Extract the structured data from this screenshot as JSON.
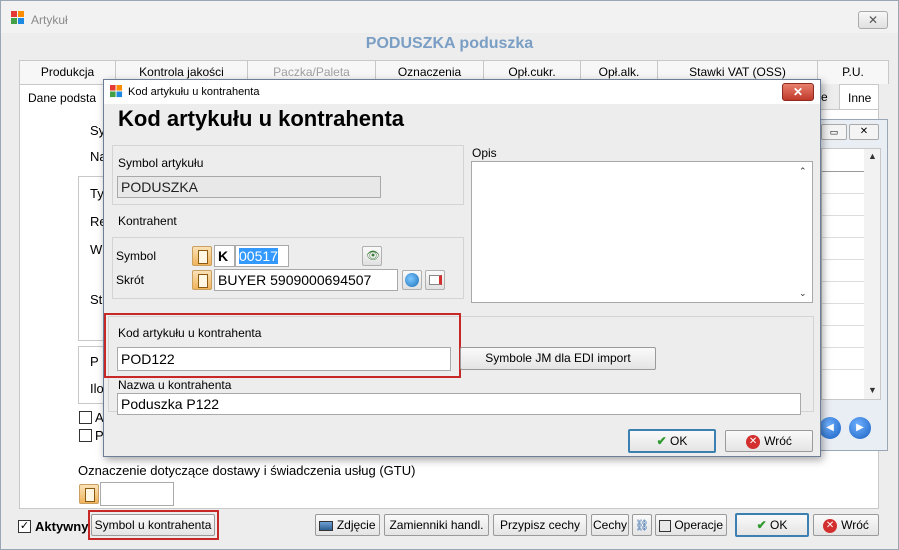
{
  "window": {
    "title": "Artykuł",
    "item_title": "PODUSZKA  poduszka"
  },
  "tabs_row1": [
    {
      "label": "Produkcja",
      "disabled": false
    },
    {
      "label": "Kontrola jakości",
      "disabled": false
    },
    {
      "label": "Paczka/Paleta",
      "disabled": true
    },
    {
      "label": "Oznaczenia",
      "disabled": false
    },
    {
      "label": "Opł.cukr.",
      "disabled": false
    },
    {
      "label": "Opł.alk.",
      "disabled": false
    },
    {
      "label": "Stawki VAT (OSS)",
      "disabled": false
    },
    {
      "label": "P.U.",
      "disabled": false
    }
  ],
  "tabs_row2": {
    "first": "Dane podsta",
    "e": "e",
    "inne": "Inne"
  },
  "background_labels": {
    "sy": "Sy",
    "na": "Na",
    "ty": "Ty",
    "re": "Re",
    "w": "W",
    "st": "St",
    "p": "P",
    "ilo": "Ilo",
    "a": "A",
    "p2": "P"
  },
  "gtu": {
    "label": "Oznaczenie dotyczące dostawy i świadczenia usług (GTU)",
    "value": ""
  },
  "footer": {
    "active_label": "Aktywny",
    "active_checked": true,
    "symbol_button": "Symbol u kontrahenta",
    "photo_button": "Zdjęcie",
    "substitutes_button": "Zamienniki handl.",
    "assign_features_button": "Przypisz cechy",
    "features_button": "Cechy",
    "operations_button": "Operacje",
    "ok_button": "OK",
    "back_button": "Wróć"
  },
  "dialog": {
    "title": "Kod artykułu u kontrahenta",
    "heading": "Kod artykułu u kontrahenta",
    "symbol_label": "Symbol artykułu",
    "symbol_value": "PODUSZKA",
    "contractor_label": "Kontrahent",
    "contractor_symbol_label": "Symbol",
    "contractor_type": "K",
    "contractor_symbol_value": "00517",
    "contractor_short_label": "Skrót",
    "contractor_short_value": "BUYER 5909000694507",
    "description_label": "Opis",
    "description_value": "",
    "code_label": "Kod artykułu u kontrahenta",
    "code_value": "POD122",
    "edi_button": "Symbole JM dla EDI import",
    "name_label": "Nazwa u kontrahenta",
    "name_value": "Poduszka P122",
    "ok_button": "OK",
    "back_button": "Wróć"
  },
  "colors": {
    "highlight_red": "#c62828",
    "title_blue": "#7a9ec4",
    "selection_blue": "#3399ff"
  }
}
